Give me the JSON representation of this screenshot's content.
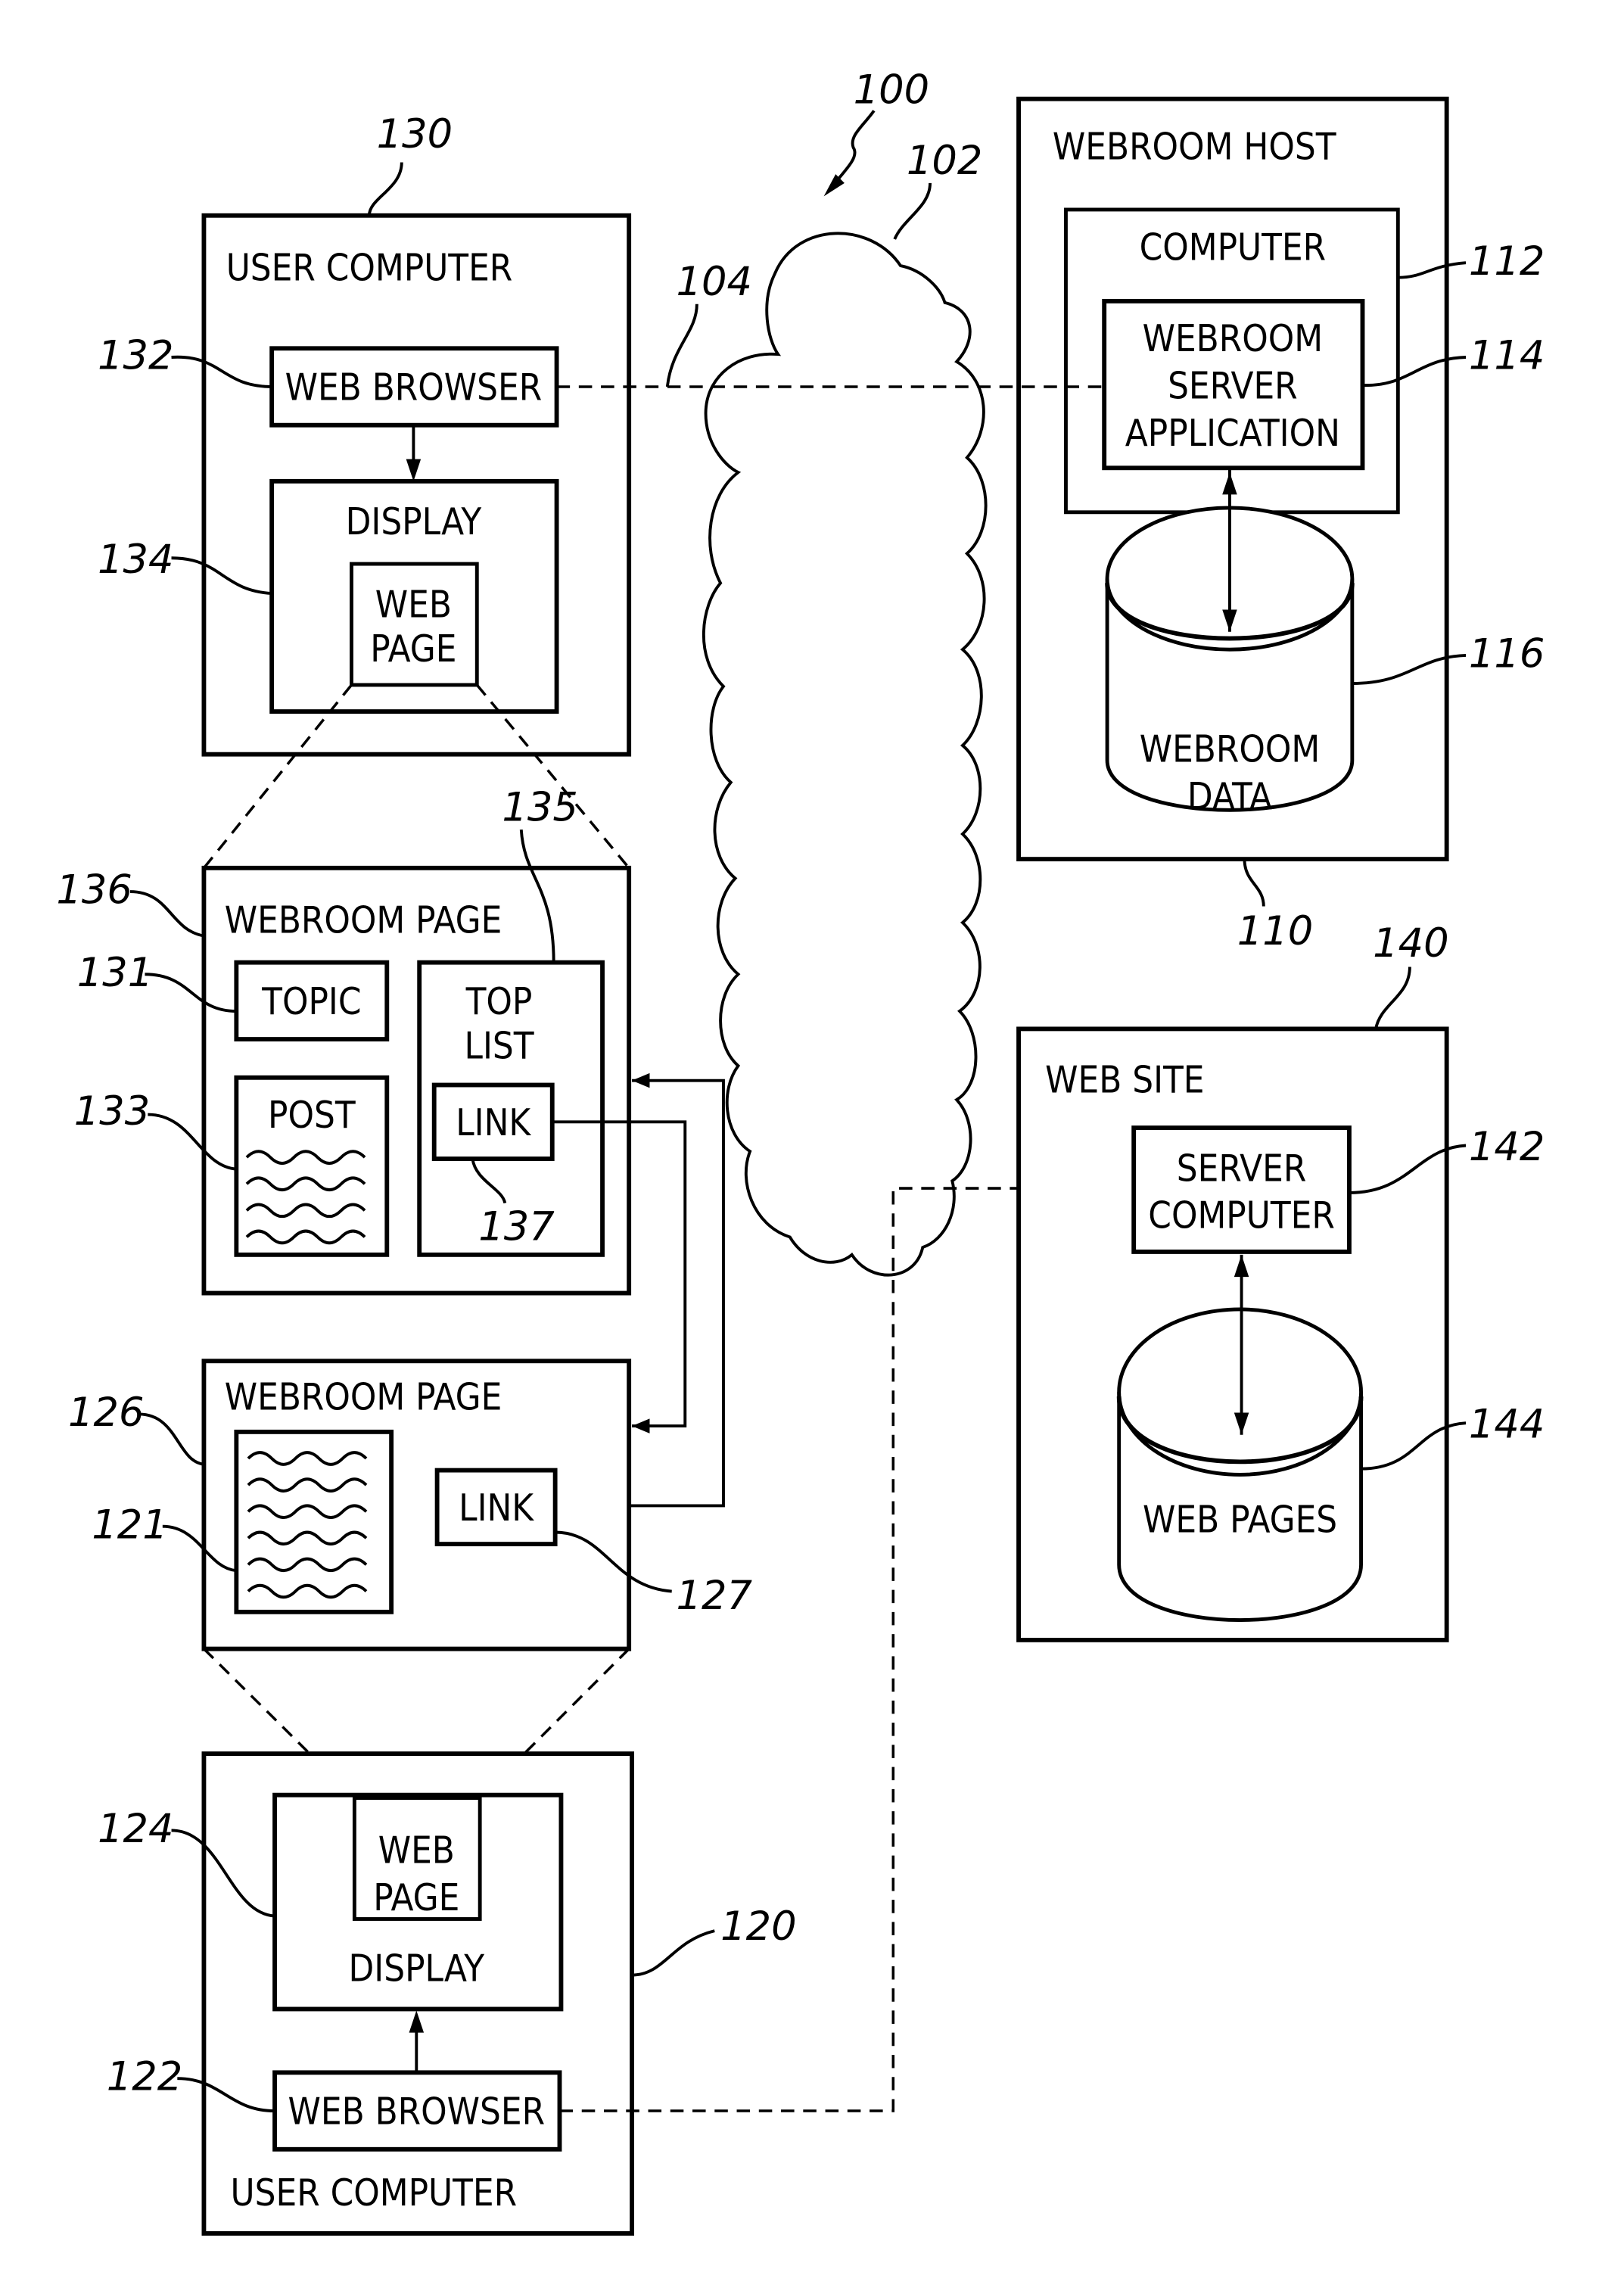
{
  "figure": {
    "system_ref": "100",
    "network": {
      "ref": "102",
      "link_ref": "104"
    },
    "webroom_host": {
      "ref": "110",
      "title": "WEBROOM HOST",
      "computer": {
        "ref": "112",
        "label": "COMPUTER"
      },
      "server_app": {
        "ref": "114",
        "lines": [
          "WEBROOM",
          "SERVER",
          "APPLICATION"
        ]
      },
      "data_store": {
        "ref": "116",
        "lines": [
          "WEBROOM",
          "DATA"
        ]
      }
    },
    "user_computer_top": {
      "ref": "130",
      "title": "USER COMPUTER",
      "browser": {
        "ref": "132",
        "label": "WEB BROWSER"
      },
      "display": {
        "ref": "134",
        "label": "DISPLAY",
        "page_lines": [
          "WEB",
          "PAGE"
        ]
      }
    },
    "webroom_page_top": {
      "ref": "136",
      "title": "WEBROOM PAGE",
      "topic": {
        "ref": "131",
        "label": "TOPIC"
      },
      "post": {
        "ref": "133",
        "label": "POST"
      },
      "top_list": {
        "ref": "135",
        "lines": [
          "TOP",
          "LIST"
        ]
      },
      "link": {
        "ref": "137",
        "label": "LINK"
      }
    },
    "webroom_page_bottom": {
      "ref": "126",
      "title": "WEBROOM PAGE",
      "content_ref": "121",
      "link": {
        "ref": "127",
        "label": "LINK"
      }
    },
    "user_computer_bottom": {
      "ref": "120",
      "title": "USER COMPUTER",
      "browser": {
        "ref": "122",
        "label": "WEB BROWSER"
      },
      "display": {
        "ref": "124",
        "label": "DISPLAY",
        "page_lines": [
          "WEB",
          "PAGE"
        ]
      }
    },
    "web_site": {
      "ref": "140",
      "title": "WEB SITE",
      "server": {
        "ref": "142",
        "lines": [
          "SERVER",
          "COMPUTER"
        ]
      },
      "pages_store": {
        "ref": "144",
        "label": "WEB PAGES"
      }
    }
  }
}
